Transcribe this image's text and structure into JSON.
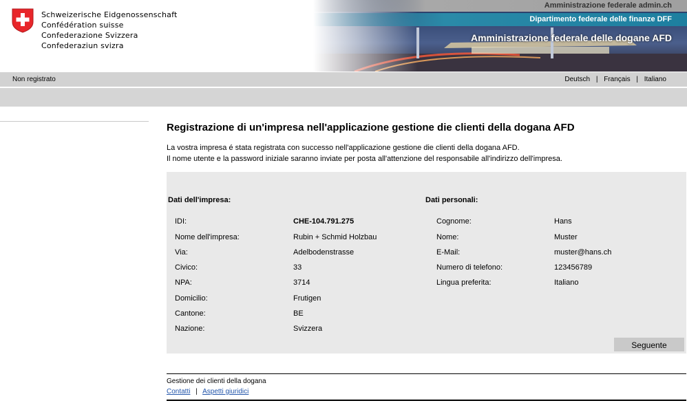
{
  "header": {
    "logo_lines": [
      "Schweizerische Eidgenossenschaft",
      "Confédération suisse",
      "Confederazione Svizzera",
      "Confederaziun svizra"
    ],
    "top_link": "Amministrazione federale admin.ch",
    "department": "Dipartimento federale delle finanze DFF",
    "office": "Amministrazione federale delle dogane AFD"
  },
  "statusbar": {
    "user_status": "Non registrato",
    "languages": [
      "Deutsch",
      "Français",
      "Italiano"
    ],
    "separator": "|"
  },
  "main": {
    "title": "Registrazione di un'impresa nell'applicazione gestione die clienti della dogana AFD",
    "intro_lines": [
      "La vostra impresa é stata registrata con successo nell'applicazione gestione die clienti della dogana AFD.",
      "Il nome utente e la password iniziale saranno inviate per posta all'attenzione del responsabile all'indirizzo dell'impresa."
    ],
    "company": {
      "heading": "Dati dell'impresa:",
      "fields": [
        {
          "label": "IDI:",
          "value": "CHE-104.791.275"
        },
        {
          "label": "Nome dell'impresa:",
          "value": "Rubin + Schmid Holzbau"
        },
        {
          "label": "Via:",
          "value": "Adelbodenstrasse"
        },
        {
          "label": "Civico:",
          "value": "33"
        },
        {
          "label": "NPA:",
          "value": "3714"
        },
        {
          "label": "Domicilio:",
          "value": "Frutigen"
        },
        {
          "label": "Cantone:",
          "value": "BE"
        },
        {
          "label": "Nazione:",
          "value": "Svizzera"
        }
      ]
    },
    "personal": {
      "heading": "Dati personali:",
      "fields": [
        {
          "label": "Cognome:",
          "value": "Hans"
        },
        {
          "label": "Nome:",
          "value": "Muster"
        },
        {
          "label": "E-Mail:",
          "value": "muster@hans.ch"
        },
        {
          "label": "Numero di telefono:",
          "value": "123456789"
        },
        {
          "label": "Lingua preferita:",
          "value": "Italiano"
        }
      ]
    },
    "next_button": "Seguente"
  },
  "footer": {
    "title": "Gestione dei clienti della dogana",
    "links": [
      "Contatti",
      "Aspetti giuridici"
    ],
    "separator": "|"
  },
  "colors": {
    "flag_red": "#e8262a",
    "department_bar": "#1d7fa0",
    "panel_bg": "#e9e9e9",
    "link": "#2255aa"
  },
  "icons": [
    "swiss-cross-icon"
  ]
}
